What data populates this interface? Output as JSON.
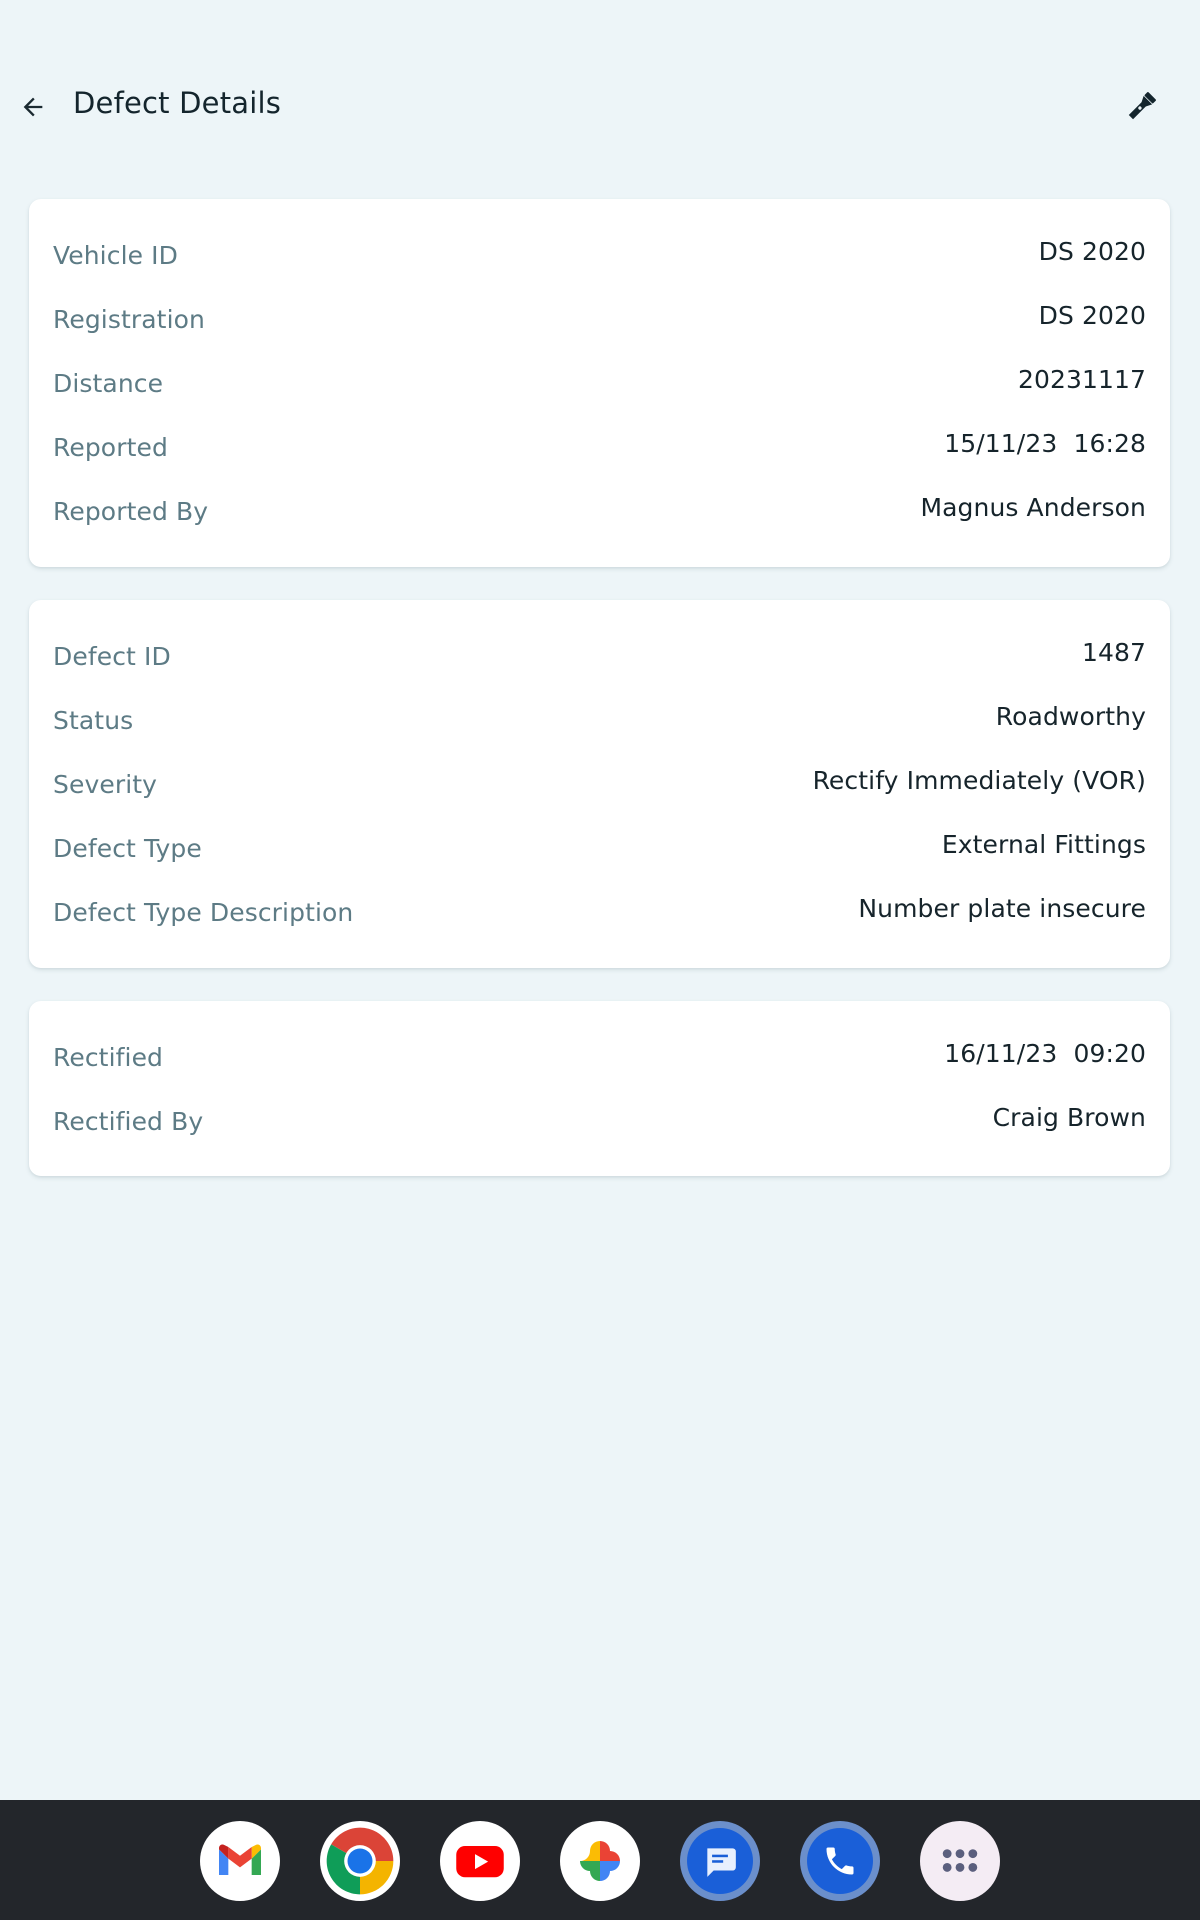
{
  "header": {
    "title": "Defect Details",
    "back_icon": "arrow-back-icon",
    "action_icon": "flashlight-icon"
  },
  "vehicle_card": {
    "rows": [
      {
        "label": "Vehicle ID",
        "value": "DS 2020"
      },
      {
        "label": "Registration",
        "value": "DS 2020"
      },
      {
        "label": "Distance",
        "value": "20231117"
      },
      {
        "label": "Reported",
        "value": "15/11/23  16:28"
      },
      {
        "label": "Reported By",
        "value": "Magnus Anderson"
      }
    ]
  },
  "defect_card": {
    "rows": [
      {
        "label": "Defect ID",
        "value": "1487"
      },
      {
        "label": "Status",
        "value": "Roadworthy"
      },
      {
        "label": "Severity",
        "value": "Rectify Immediately (VOR)"
      },
      {
        "label": "Defect Type",
        "value": "External Fittings"
      },
      {
        "label": "Defect Type Description",
        "value": "Number plate insecure"
      }
    ]
  },
  "rectified_card": {
    "rows": [
      {
        "label": "Rectified",
        "value": "16/11/23  09:20"
      },
      {
        "label": "Rectified By",
        "value": "Craig Brown"
      }
    ]
  },
  "dock": {
    "apps": [
      "gmail-icon",
      "chrome-icon",
      "youtube-icon",
      "photos-icon",
      "messages-icon",
      "phone-icon",
      "app-drawer-icon"
    ]
  },
  "colors": {
    "background": "#edf5f8",
    "card": "#ffffff",
    "label": "#5d7b85",
    "value": "#16242b",
    "navbar": "#23262b"
  }
}
